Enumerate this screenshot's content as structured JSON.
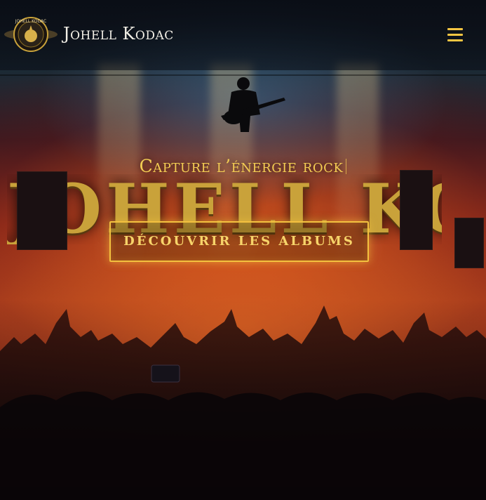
{
  "header": {
    "site_title": "Johell Kodac",
    "logo_text": "JOHELL KODAC"
  },
  "hero": {
    "background_word": "JOHELL KODAC",
    "tagline": "Capture l’énergie rock",
    "cta_label": "DÉCOUVRIR LES ALBUMS"
  },
  "colors": {
    "accent": "#f3c13f",
    "title": "#f2efe6",
    "background": "#0b0b12"
  },
  "icons": {
    "menu": "hamburger-menu-icon",
    "logo": "logo-emblem"
  }
}
